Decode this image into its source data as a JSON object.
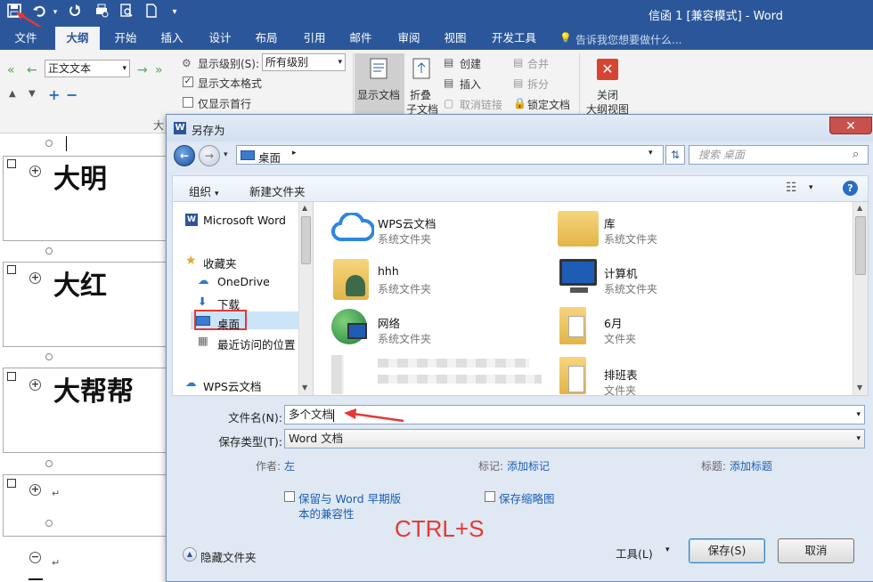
{
  "window": {
    "title": "信函 1 [兼容模式] - Word"
  },
  "tabs": [
    "文件",
    "大纲",
    "开始",
    "插入",
    "设计",
    "布局",
    "引用",
    "邮件",
    "审阅",
    "视图",
    "开发工具"
  ],
  "tell_me": "告诉我您想要做什么...",
  "ribbon": {
    "level_value": "正文文本",
    "show_level_label": "显示级别(S):",
    "show_level_value": "所有级别",
    "show_text_format": "显示文本格式",
    "show_first_line": "仅显示首行",
    "show_doc": "显示文档",
    "collapse": "折叠",
    "subdoc": "子文档",
    "create": "创建",
    "insert": "插入",
    "unlink": "取消链接",
    "merge": "合并",
    "split": "拆分",
    "lock_doc": "锁定文档",
    "close_outline_1": "关闭",
    "close_outline_2": "大纲视图",
    "partial_label": "大"
  },
  "document": {
    "headings": [
      "大明",
      "大红",
      "大帮帮"
    ],
    "para_mark": "↵"
  },
  "dialog": {
    "title": "另存为",
    "address": "桌面",
    "search_placeholder": "搜索 桌面",
    "organize": "组织",
    "new_folder": "新建文件夹",
    "nav": {
      "word": "Microsoft Word",
      "favorites": "收藏夹",
      "onedrive": "OneDrive",
      "downloads": "下载",
      "desktop": "桌面",
      "recent": "最近访问的位置",
      "wps": "WPS云文档"
    },
    "files": [
      {
        "name": "WPS云文档",
        "type": "系统文件夹"
      },
      {
        "name": "库",
        "type": "系统文件夹"
      },
      {
        "name": "hhh",
        "type": "系统文件夹"
      },
      {
        "name": "计算机",
        "type": "系统文件夹"
      },
      {
        "name": "网络",
        "type": "系统文件夹"
      },
      {
        "name": "6月",
        "type": "文件夹"
      },
      {
        "name": "排班表",
        "type": "文件夹"
      }
    ],
    "filename_label": "文件名(N):",
    "filename_value": "多个文档",
    "filetype_label": "保存类型(T):",
    "filetype_value": "Word 文档",
    "author_label": "作者:",
    "author_value": "左",
    "tags_label": "标记:",
    "tags_value": "添加标记",
    "title_label": "标题:",
    "title_value": "添加标题",
    "keep_compat_1": "保留与 Word 早期版",
    "keep_compat_2": "本的兼容性",
    "save_thumb": "保存缩略图",
    "hide_folders": "隐藏文件夹",
    "tools": "工具(L)",
    "save": "保存(S)",
    "cancel": "取消"
  },
  "annotation": {
    "shortcut": "CTRL+S"
  },
  "colors": {
    "word_blue": "#2b579a",
    "annotation_red": "#e53935"
  }
}
